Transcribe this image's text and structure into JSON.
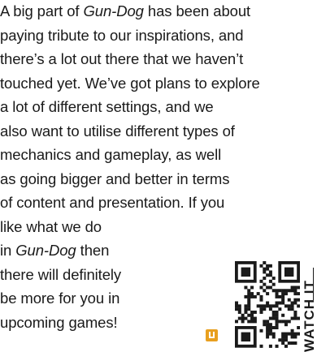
{
  "article": {
    "lines": [
      {
        "pre": "A big part of ",
        "em": "Gun-Dog",
        "post": " has been about"
      },
      {
        "pre": "paying tribute to our inspirations, and",
        "em": "",
        "post": ""
      },
      {
        "pre": "there’s a lot out there that we haven’t",
        "em": "",
        "post": ""
      },
      {
        "pre": "touched yet. We’ve got plans to explore",
        "em": "",
        "post": ""
      },
      {
        "pre": "a lot of different settings, and we",
        "em": "",
        "post": ""
      },
      {
        "pre": "also want to utilise different types of",
        "em": "",
        "post": ""
      },
      {
        "pre": "mechanics and gameplay, as well",
        "em": "",
        "post": ""
      },
      {
        "pre": "as going bigger and better in terms",
        "em": "",
        "post": ""
      },
      {
        "pre": "of content and presentation. If you",
        "em": "",
        "post": ""
      },
      {
        "pre": "like what we do",
        "em": "",
        "post": ""
      },
      {
        "pre": "in ",
        "em": "Gun-Dog",
        "post": " then"
      },
      {
        "pre": "there will definitely",
        "em": "",
        "post": ""
      },
      {
        "pre": "be more for you in",
        "em": "",
        "post": ""
      },
      {
        "pre": "upcoming games!",
        "em": "",
        "post": ""
      }
    ]
  },
  "side_label": "WATCH IT",
  "icons": {
    "end_mark": "end-of-article-mark",
    "qr": "qr-code"
  },
  "colors": {
    "text": "#1a1a1a",
    "accent": "#e8a020"
  }
}
